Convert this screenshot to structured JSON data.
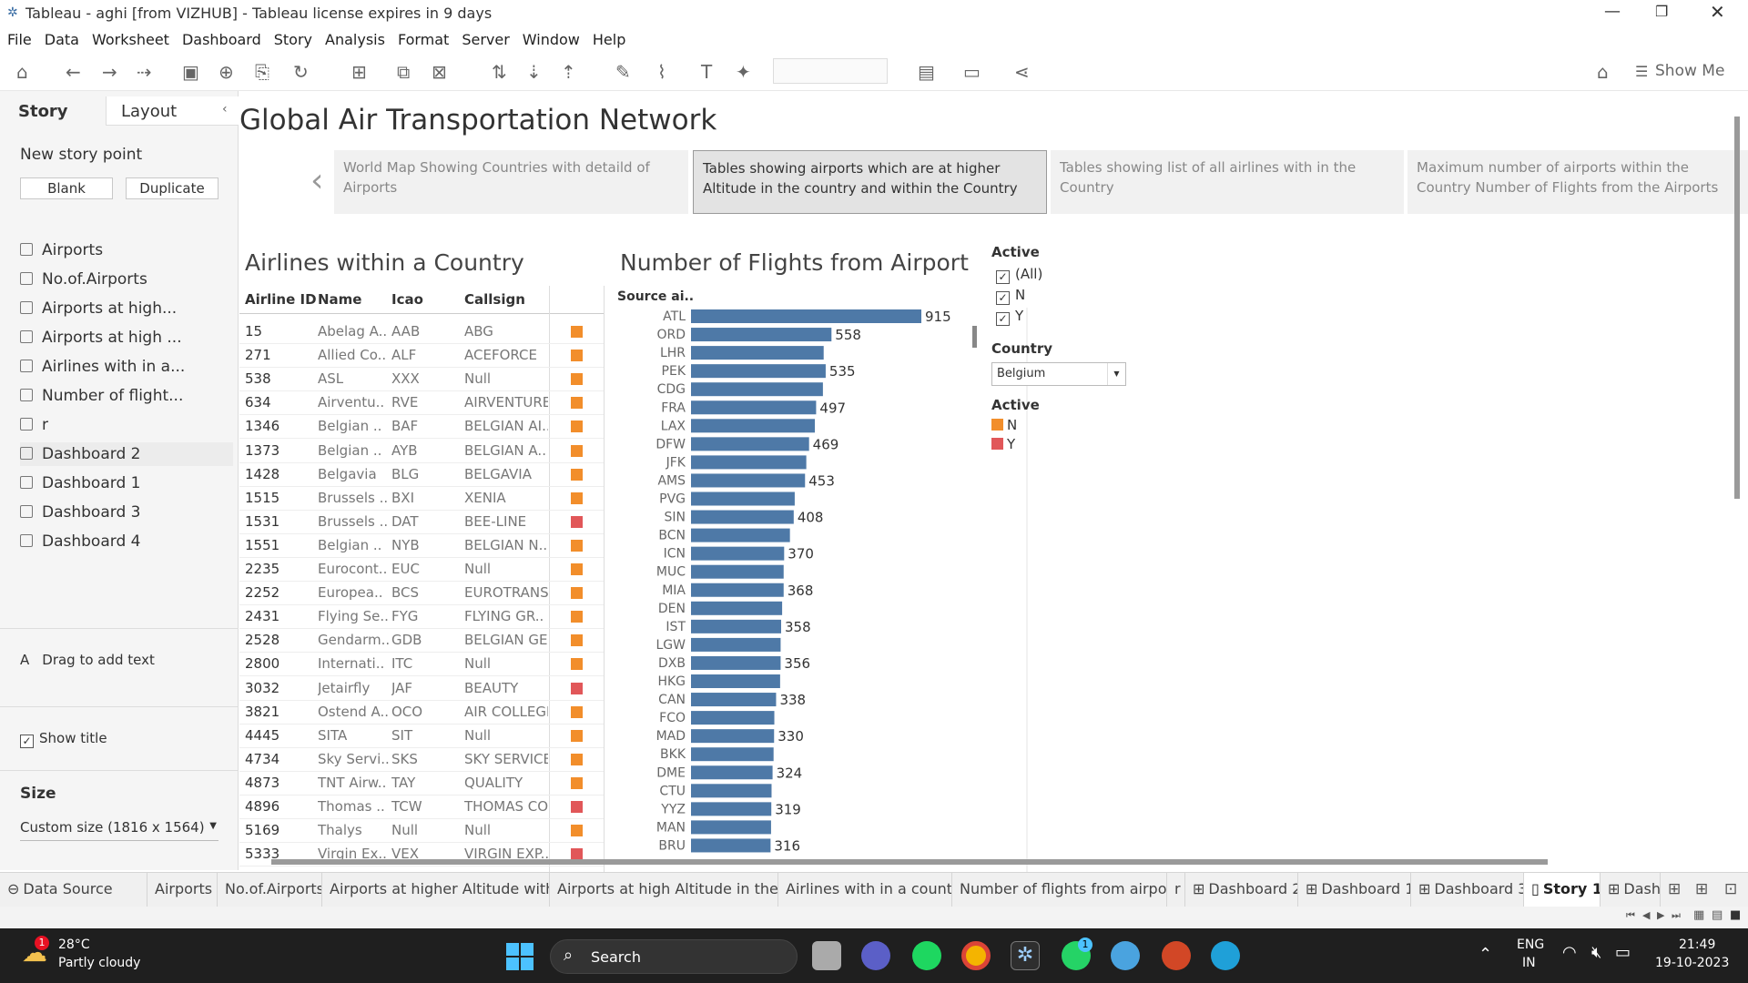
{
  "window": {
    "title": "Tableau - aghi [from VIZHUB] - Tableau license expires in 9 days"
  },
  "menu": [
    "File",
    "Data",
    "Worksheet",
    "Dashboard",
    "Story",
    "Analysis",
    "Format",
    "Server",
    "Window",
    "Help"
  ],
  "toolbar": {
    "show_me": "Show Me"
  },
  "left": {
    "tab_story": "Story",
    "tab_layout": "Layout",
    "new_story_point": "New story point",
    "blank": "Blank",
    "duplicate": "Duplicate",
    "sheets": [
      "Airports",
      "No.of.Airports",
      "Airports at high...",
      "Airports at high ...",
      "Airlines with in a...",
      "Number of flight...",
      "r",
      "Dashboard 2",
      "Dashboard 1",
      "Dashboard 3",
      "Dashboard 4"
    ],
    "drag_text": "Drag to add text",
    "show_title": "Show title",
    "size_label": "Size",
    "size_value": "Custom size (1816 x 1564)"
  },
  "story": {
    "title": "Global Air Transportation Network",
    "points": [
      "World Map Showing Countries with detaild of Airports",
      "Tables showing airports which are at higher Altitude in the country and within the Country",
      "Tables showing list of all airlines with in the Country",
      "Maximum number of airports within the Country Number of Flights from the Airports"
    ]
  },
  "airlines": {
    "title": "Airlines within a Country",
    "headers": [
      "Airline ID",
      "Name",
      "Icao",
      "Callsign"
    ],
    "rows": [
      [
        "15",
        "Abelag A..",
        "AAB",
        "ABG",
        "N"
      ],
      [
        "271",
        "Allied Co..",
        "ALF",
        "ACEFORCE",
        "N"
      ],
      [
        "538",
        "ASL",
        "XXX",
        "Null",
        "N"
      ],
      [
        "634",
        "Airventu..",
        "RVE",
        "AIRVENTURE",
        "N"
      ],
      [
        "1346",
        "Belgian ..",
        "BAF",
        "BELGIAN AI..",
        "N"
      ],
      [
        "1373",
        "Belgian ..",
        "AYB",
        "BELGIAN A..",
        "N"
      ],
      [
        "1428",
        "Belgavia",
        "BLG",
        "BELGAVIA",
        "N"
      ],
      [
        "1515",
        "Brussels ..",
        "BXI",
        "XENIA",
        "N"
      ],
      [
        "1531",
        "Brussels ..",
        "DAT",
        "BEE-LINE",
        "Y"
      ],
      [
        "1551",
        "Belgian ..",
        "NYB",
        "BELGIAN N..",
        "N"
      ],
      [
        "2235",
        "Eurocont..",
        "EUC",
        "Null",
        "N"
      ],
      [
        "2252",
        "Europea..",
        "BCS",
        "EUROTRANS",
        "N"
      ],
      [
        "2431",
        "Flying Se..",
        "FYG",
        "FLYING GR..",
        "N"
      ],
      [
        "2528",
        "Gendarm..",
        "GDB",
        "BELGIAN GE..",
        "N"
      ],
      [
        "2800",
        "Internati..",
        "ITC",
        "Null",
        "N"
      ],
      [
        "3032",
        "Jetairfly",
        "JAF",
        "BEAUTY",
        "Y"
      ],
      [
        "3821",
        "Ostend A..",
        "OCO",
        "AIR COLLEGE",
        "N"
      ],
      [
        "4445",
        "SITA",
        "SIT",
        "Null",
        "N"
      ],
      [
        "4734",
        "Sky Servi..",
        "SKS",
        "SKY SERVICE",
        "N"
      ],
      [
        "4873",
        "TNT Airw..",
        "TAY",
        "QUALITY",
        "N"
      ],
      [
        "4896",
        "Thomas ..",
        "TCW",
        "THOMAS CO..",
        "Y"
      ],
      [
        "5169",
        "Thalys",
        "Null",
        "Null",
        "N"
      ],
      [
        "5333",
        "Virgin Ex..",
        "VEX",
        "VIRGIN EXP..",
        "Y"
      ]
    ]
  },
  "chart_data": {
    "type": "bar",
    "title": "Number of Flights from Airport",
    "ylabel": "Source ai..",
    "categories": [
      "ATL",
      "ORD",
      "LHR",
      "PEK",
      "CDG",
      "FRA",
      "LAX",
      "DFW",
      "JFK",
      "AMS",
      "PVG",
      "SIN",
      "BCN",
      "ICN",
      "MUC",
      "MIA",
      "DEN",
      "IST",
      "LGW",
      "DXB",
      "HKG",
      "CAN",
      "FCO",
      "MAD",
      "BKK",
      "DME",
      "CTU",
      "YYZ",
      "MAN",
      "BRU"
    ],
    "values": [
      915,
      558,
      527,
      535,
      524,
      497,
      492,
      469,
      458,
      453,
      412,
      408,
      393,
      370,
      368,
      368,
      362,
      358,
      356,
      356,
      354,
      338,
      331,
      330,
      328,
      324,
      320,
      319,
      318,
      316
    ],
    "labels": [
      "915",
      "558",
      "",
      "535",
      "",
      "497",
      "",
      "469",
      "",
      "453",
      "",
      "408",
      "",
      "370",
      "",
      "368",
      "",
      "358",
      "",
      "356",
      "",
      "338",
      "",
      "330",
      "",
      "324",
      "",
      "319",
      "",
      "316"
    ],
    "xlim": [
      0,
      915
    ]
  },
  "filters": {
    "active_title": "Active",
    "active_options": [
      "(All)",
      "N",
      "Y"
    ],
    "country_title": "Country",
    "country_value": "Belgium",
    "legend_title": "Active",
    "legend": [
      {
        "label": "N",
        "color": "#f28e2b"
      },
      {
        "label": "Y",
        "color": "#e15759"
      }
    ]
  },
  "colors": {
    "N": "#f28e2b",
    "Y": "#e15759",
    "bar": "#4e79a7"
  },
  "sheet_tabs": [
    "Data Source",
    "Airports",
    "No.of.Airports",
    "Airports at higher Altitude with i...",
    "Airports at high Altitude in the W...",
    "Airlines with in a country",
    "Number of flights from airport",
    "r",
    "Dashboard 2",
    "Dashboard 1",
    "Dashboard 3",
    "Story 1",
    "Dashb"
  ],
  "taskbar": {
    "temp": "28°C",
    "weather": "Partly cloudy",
    "search": "Search",
    "lang1": "ENG",
    "lang2": "IN",
    "time": "21:49",
    "date": "19-10-2023",
    "weather_badge": "1",
    "whatsapp_badge": "1"
  }
}
